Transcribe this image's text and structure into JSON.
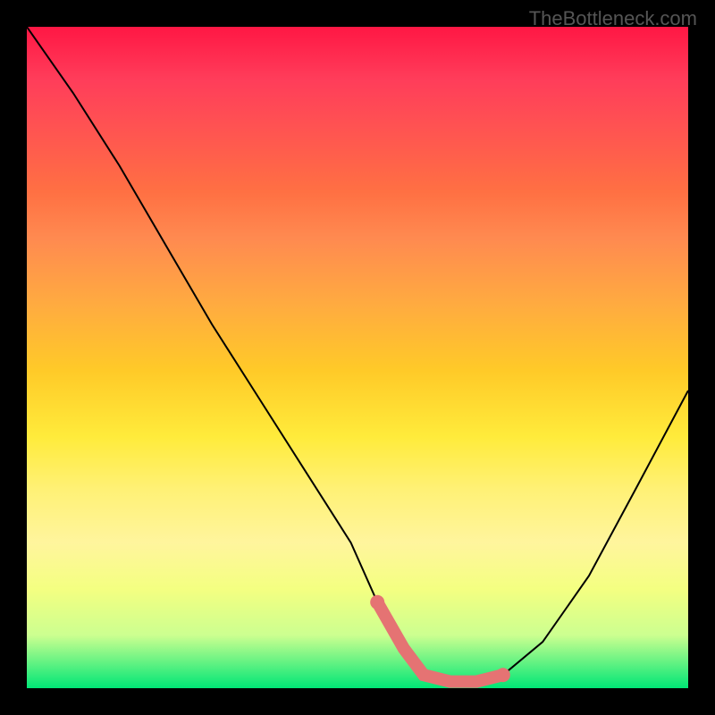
{
  "watermark": "TheBottleneck.com",
  "chart_data": {
    "type": "line",
    "title": "",
    "xlabel": "",
    "ylabel": "",
    "xlim": [
      0,
      100
    ],
    "ylim": [
      0,
      100
    ],
    "series": [
      {
        "name": "bottleneck-curve",
        "x": [
          0,
          7,
          14,
          21,
          28,
          35,
          42,
          49,
          53,
          57,
          60,
          64,
          68,
          72,
          78,
          85,
          92,
          100
        ],
        "values": [
          100,
          90,
          79,
          67,
          55,
          44,
          33,
          22,
          13,
          6,
          2,
          1,
          1,
          2,
          7,
          17,
          30,
          45
        ]
      }
    ],
    "highlight": {
      "name": "optimal-region",
      "color": "#e57373",
      "x": [
        53,
        57,
        60,
        64,
        68,
        72
      ],
      "values": [
        13,
        6,
        2,
        1,
        1,
        2
      ]
    },
    "gradient_stops": [
      {
        "pos": 0,
        "color": "#ff1744"
      },
      {
        "pos": 8,
        "color": "#ff3d5a"
      },
      {
        "pos": 15,
        "color": "#ff5252"
      },
      {
        "pos": 25,
        "color": "#ff7043"
      },
      {
        "pos": 32,
        "color": "#ff8a50"
      },
      {
        "pos": 42,
        "color": "#ffab40"
      },
      {
        "pos": 52,
        "color": "#ffca28"
      },
      {
        "pos": 62,
        "color": "#ffeb3b"
      },
      {
        "pos": 70,
        "color": "#fff176"
      },
      {
        "pos": 78,
        "color": "#fff59d"
      },
      {
        "pos": 85,
        "color": "#f4ff81"
      },
      {
        "pos": 92,
        "color": "#ccff90"
      },
      {
        "pos": 100,
        "color": "#00e676"
      }
    ]
  }
}
